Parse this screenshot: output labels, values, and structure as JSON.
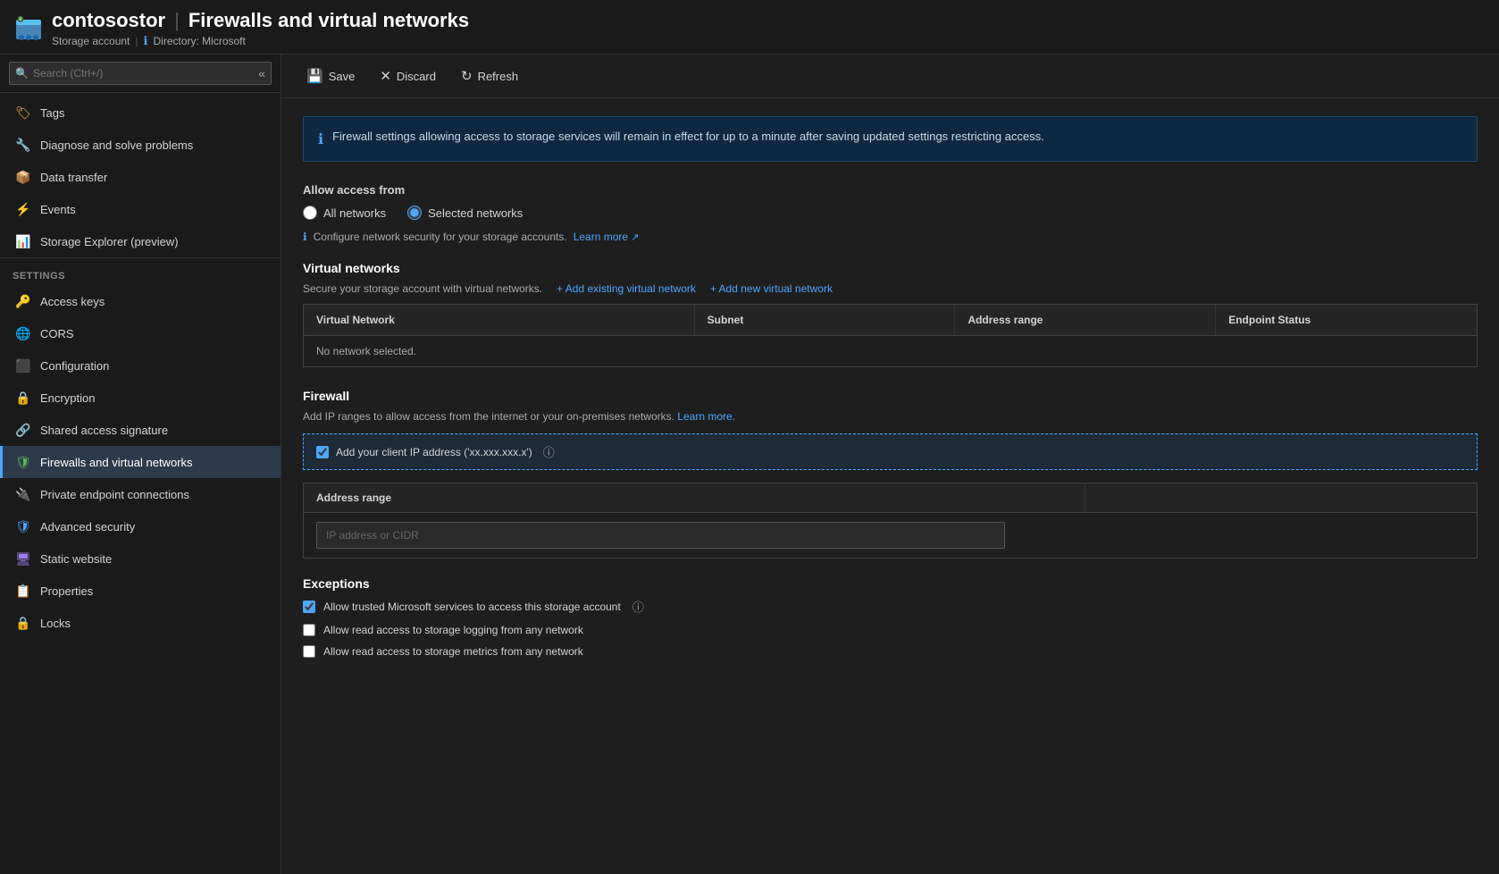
{
  "header": {
    "icon": "storage-account-icon",
    "resource_name": "contosostor",
    "page_title": "Firewalls and virtual networks",
    "subtitle_type": "Storage account",
    "subtitle_separator": "|",
    "subtitle_info_icon": "ℹ",
    "subtitle_directory": "Directory: Microsoft"
  },
  "toolbar": {
    "save_label": "Save",
    "discard_label": "Discard",
    "refresh_label": "Refresh"
  },
  "sidebar": {
    "search_placeholder": "Search (Ctrl+/)",
    "items": [
      {
        "id": "tags",
        "label": "Tags",
        "icon": "🏷"
      },
      {
        "id": "diagnose",
        "label": "Diagnose and solve problems",
        "icon": "🔧"
      },
      {
        "id": "data-transfer",
        "label": "Data transfer",
        "icon": "📦"
      },
      {
        "id": "events",
        "label": "Events",
        "icon": "⚡"
      },
      {
        "id": "storage-explorer",
        "label": "Storage Explorer (preview)",
        "icon": "📊"
      }
    ],
    "settings_section_label": "Settings",
    "settings_items": [
      {
        "id": "access-keys",
        "label": "Access keys",
        "icon": "🔑"
      },
      {
        "id": "cors",
        "label": "CORS",
        "icon": "🌐"
      },
      {
        "id": "configuration",
        "label": "Configuration",
        "icon": "⬛"
      },
      {
        "id": "encryption",
        "label": "Encryption",
        "icon": "🔒"
      },
      {
        "id": "shared-access-signature",
        "label": "Shared access signature",
        "icon": "🔗"
      },
      {
        "id": "firewalls",
        "label": "Firewalls and virtual networks",
        "icon": "🛡",
        "active": true
      },
      {
        "id": "private-endpoint",
        "label": "Private endpoint connections",
        "icon": "🔌"
      },
      {
        "id": "advanced-security",
        "label": "Advanced security",
        "icon": "🛡"
      },
      {
        "id": "static-website",
        "label": "Static website",
        "icon": "🖥"
      },
      {
        "id": "properties",
        "label": "Properties",
        "icon": "📋"
      },
      {
        "id": "locks",
        "label": "Locks",
        "icon": "🔒"
      }
    ]
  },
  "content": {
    "info_banner": "Firewall settings allowing access to storage services will remain in effect for up to a minute after saving updated settings restricting access.",
    "allow_access_from": "Allow access from",
    "radio_options": [
      {
        "id": "all-networks",
        "label": "All networks",
        "checked": false
      },
      {
        "id": "selected-networks",
        "label": "Selected networks",
        "checked": true
      }
    ],
    "config_note": "Configure network security for your storage accounts.",
    "learn_more_label": "Learn more",
    "virtual_networks_title": "Virtual networks",
    "virtual_networks_desc": "Secure your storage account with virtual networks.",
    "add_existing_label": "+ Add existing virtual network",
    "add_new_label": "+ Add new virtual network",
    "table_headers": [
      "Virtual Network",
      "Subnet",
      "Address range",
      "Endpoint Status"
    ],
    "table_no_data": "No network selected.",
    "firewall_title": "Firewall",
    "firewall_desc": "Add IP ranges to allow access from the internet or your on-premises networks.",
    "firewall_learn_more": "Learn more.",
    "client_ip_label": "Add your client IP address ('xx.xxx.xxx.x')",
    "address_range_headers": [
      "Address range",
      ""
    ],
    "ip_placeholder": "IP address or CIDR",
    "exceptions_title": "Exceptions",
    "exception_items": [
      {
        "id": "trusted-ms",
        "label": "Allow trusted Microsoft services to access this storage account",
        "checked": true,
        "has_info": true
      },
      {
        "id": "read-logging",
        "label": "Allow read access to storage logging from any network",
        "checked": false
      },
      {
        "id": "read-metrics",
        "label": "Allow read access to storage metrics from any network",
        "checked": false
      }
    ]
  }
}
